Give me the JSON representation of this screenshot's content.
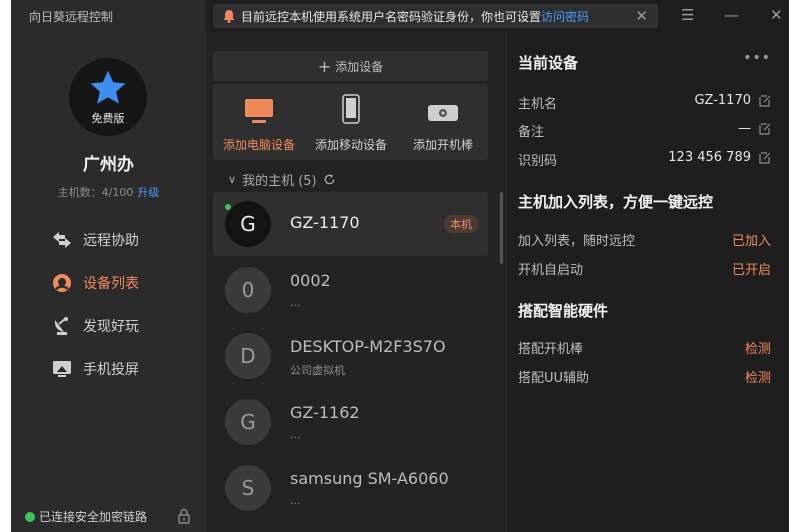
{
  "app": {
    "title": "向日葵远程控制"
  },
  "profile": {
    "edition": "免费版",
    "device_name": "广州办",
    "host_count": "主机数：4/100",
    "upgrade_label": "升级"
  },
  "nav": {
    "items": [
      {
        "label": "远程协助",
        "icon": "remote-assist-icon"
      },
      {
        "label": "设备列表",
        "icon": "device-list-icon",
        "active": true
      },
      {
        "label": "发现好玩",
        "icon": "discover-icon"
      },
      {
        "label": "手机投屏",
        "icon": "screen-cast-icon"
      }
    ]
  },
  "status": {
    "connection": "已连接安全加密链路"
  },
  "notice": {
    "text": "目前远控本机使用系统用户名密码验证身份，你也可设置",
    "link": "访问密码"
  },
  "devices_panel": {
    "add_button": "添加设备",
    "add_options": [
      "添加电脑设备",
      "添加移动设备",
      "添加开机棒"
    ],
    "group_label": "我的主机 (5)",
    "devices": [
      {
        "initial": "G",
        "name": "GZ-1170",
        "sub": "",
        "tag": "本机",
        "online": true,
        "selected": true
      },
      {
        "initial": "0",
        "name": "0002",
        "sub": "..."
      },
      {
        "initial": "D",
        "name": "DESKTOP-M2F3S7O",
        "sub": "公司虚拟机"
      },
      {
        "initial": "G",
        "name": "GZ-1162",
        "sub": "..."
      },
      {
        "initial": "S",
        "name": "samsung SM-A6060",
        "sub": "..."
      }
    ]
  },
  "details": {
    "current_title": "当前设备",
    "host_label": "主机名",
    "host_value": "GZ-1170",
    "note_label": "备注",
    "note_value": "—",
    "id_label": "识别码",
    "id_value": "123 456 789",
    "join_title": "主机加入列表，方便一键远控",
    "join_label": "加入列表，随时远控",
    "join_value": "已加入",
    "autostart_label": "开机自启动",
    "autostart_value": "已开启",
    "hardware_title": "搭配智能硬件",
    "power_stick_label": "搭配开机棒",
    "power_stick_value": "检测",
    "uu_label": "搭配UU辅助",
    "uu_value": "检测"
  },
  "colors": {
    "accent": "#f08a5d",
    "link": "#4a9cff",
    "online": "#3cc45a",
    "badge_blue": "#3d8ef0"
  }
}
